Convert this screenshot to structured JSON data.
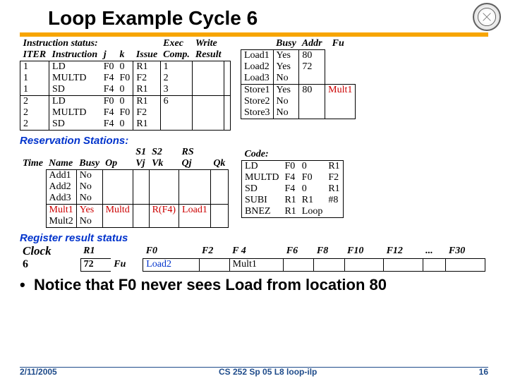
{
  "title": "Loop Example Cycle 6",
  "instr": {
    "head": "Instruction status:",
    "exec": "Exec",
    "write": "Write",
    "h": [
      "ITER",
      "Instruction",
      "j",
      "k",
      "Issue",
      "Comp.",
      "Result"
    ],
    "r": [
      [
        "1",
        "LD",
        "F0",
        "0",
        "R1",
        "1",
        "",
        ""
      ],
      [
        "1",
        "MULTD",
        "F4",
        "F0",
        "F2",
        "2",
        "",
        ""
      ],
      [
        "1",
        "SD",
        "F4",
        "0",
        "R1",
        "3",
        "",
        ""
      ],
      [
        "2",
        "LD",
        "F0",
        "0",
        "R1",
        "6",
        "",
        ""
      ],
      [
        "2",
        "MULTD",
        "F4",
        "F0",
        "F2",
        "",
        "",
        ""
      ],
      [
        "2",
        "SD",
        "F4",
        "0",
        "R1",
        "",
        "",
        ""
      ]
    ]
  },
  "ls": {
    "h": [
      "Busy",
      "Addr",
      "Fu"
    ],
    "r": [
      [
        "Load1",
        "Yes",
        "80",
        ""
      ],
      [
        "Load2",
        "Yes",
        "72",
        ""
      ],
      [
        "Load3",
        "No",
        "",
        ""
      ],
      [
        "Store1",
        "Yes",
        "80",
        "Mult1"
      ],
      [
        "Store2",
        "No",
        "",
        ""
      ],
      [
        "Store3",
        "No",
        "",
        ""
      ]
    ]
  },
  "rs": {
    "head": "Reservation Stations:",
    "h": [
      "",
      "",
      "",
      "",
      "S1",
      "S2",
      "RS",
      ""
    ],
    "h2": [
      "Time",
      "Name",
      "Busy",
      "Op",
      "Vj",
      "Vk",
      "Qj",
      "Qk"
    ],
    "r": [
      [
        "Add1",
        "No"
      ],
      [
        "Add2",
        "No"
      ],
      [
        "Add3",
        "No"
      ],
      [
        "Mult1",
        "Yes",
        "Multd",
        "",
        "R(F4)",
        "Load1"
      ],
      [
        "Mult2",
        "No"
      ]
    ]
  },
  "code": {
    "head": "Code:",
    "r": [
      [
        "LD",
        "F0",
        "0",
        "R1"
      ],
      [
        "MULTD",
        "F4",
        "F0",
        "F2"
      ],
      [
        "SD",
        "F4",
        "0",
        "R1"
      ],
      [
        "SUBI",
        "R1",
        "R1",
        "#8"
      ],
      [
        "BNEZ",
        "R1",
        "Loop",
        ""
      ]
    ]
  },
  "rrs": {
    "head": "Register result status",
    "h": [
      "Clock",
      "R1",
      "F0",
      "F2",
      "F 4",
      "F6",
      "F8",
      "F10",
      "F12",
      "...",
      "F30"
    ],
    "r": [
      "6",
      "72",
      "Fu",
      "Load2",
      "",
      "Mult1"
    ]
  },
  "note": "Notice that F0 never sees Load from location 80",
  "footer": {
    "date": "2/11/2005",
    "course": "CS 252 Sp 05 L8 loop-ilp",
    "page": "16"
  }
}
